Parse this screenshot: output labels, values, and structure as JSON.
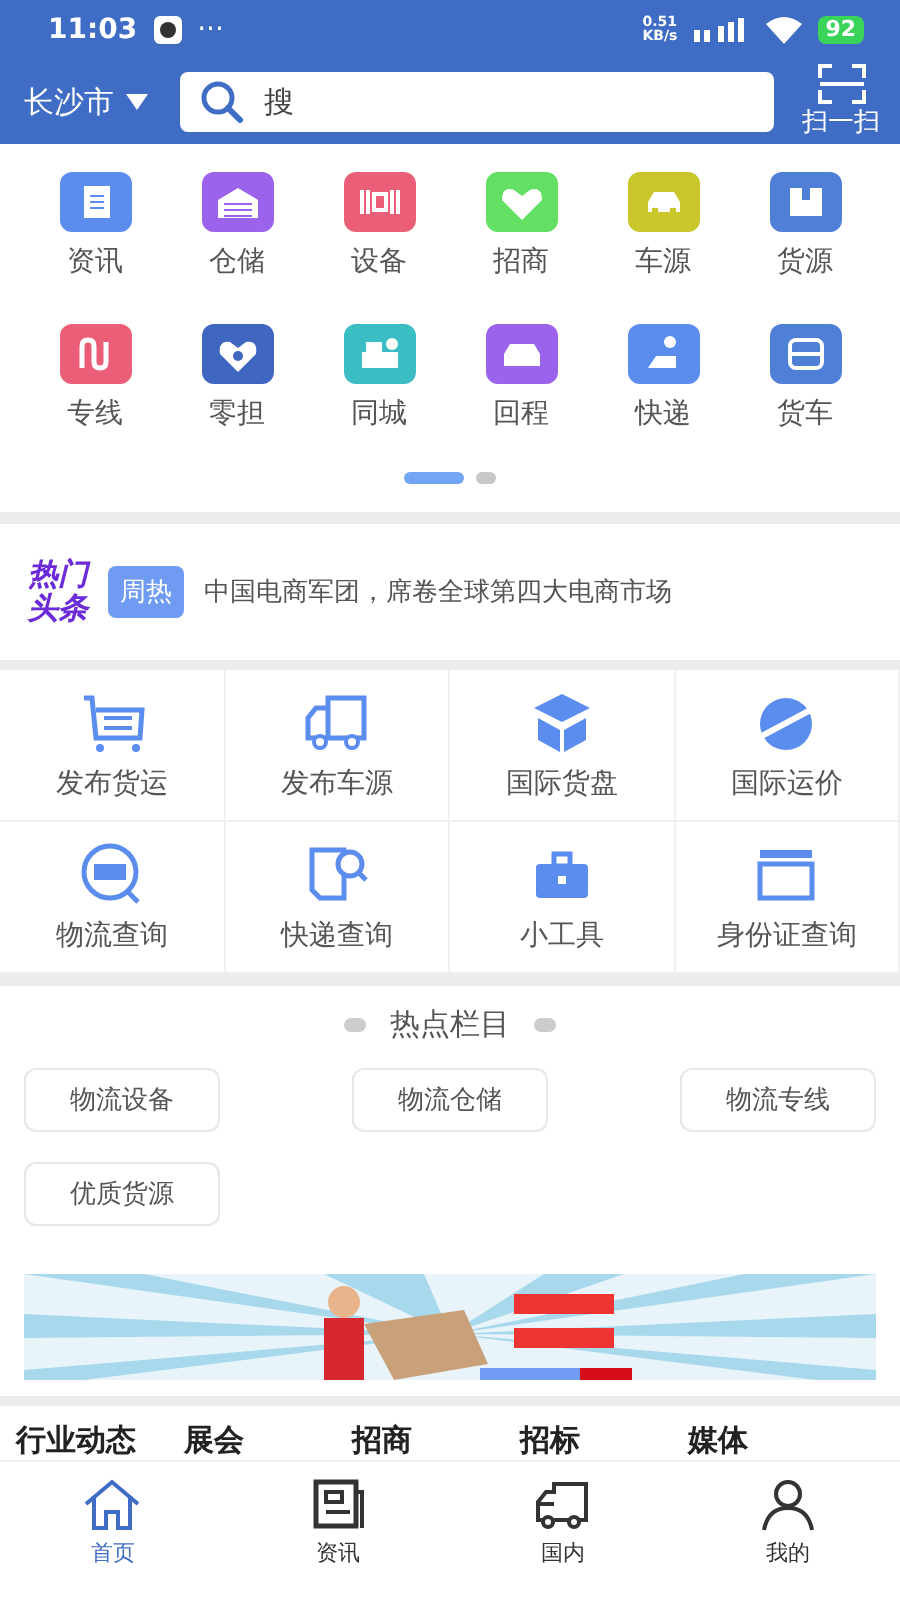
{
  "status_bar": {
    "time": "11:03",
    "more": "···",
    "speed": "0.51\nKB/s",
    "battery": "92"
  },
  "header": {
    "city": "长沙市",
    "search_placeholder": "搜",
    "scan_label": "扫一扫"
  },
  "categories": [
    {
      "label": "资讯",
      "color": "#5b8def"
    },
    {
      "label": "仓储",
      "color": "#9b63ec"
    },
    {
      "label": "设备",
      "color": "#eb5e78"
    },
    {
      "label": "招商",
      "color": "#63e063"
    },
    {
      "label": "车源",
      "color": "#c9c62c"
    },
    {
      "label": "货源",
      "color": "#4f7fd6"
    },
    {
      "label": "专线",
      "color": "#eb5e78"
    },
    {
      "label": "零担",
      "color": "#3f66c0"
    },
    {
      "label": "同城",
      "color": "#3bbdc4"
    },
    {
      "label": "回程",
      "color": "#9b63ec"
    },
    {
      "label": "快递",
      "color": "#5b8def"
    },
    {
      "label": "货车",
      "color": "#4f7fd6"
    }
  ],
  "pager": [
    {
      "selected": true
    },
    {
      "selected": false
    }
  ],
  "headline": {
    "logo": [
      "热门",
      "头条"
    ],
    "tag": "周热",
    "text": "中国电商军团，席卷全球第四大电商市场"
  },
  "services": [
    {
      "label": "发布货运"
    },
    {
      "label": "发布车源"
    },
    {
      "label": "国际货盘"
    },
    {
      "label": "国际运价"
    },
    {
      "label": "物流查询"
    },
    {
      "label": "快递查询"
    },
    {
      "label": "小工具"
    },
    {
      "label": "身份证查询"
    }
  ],
  "hot": {
    "title": "热点栏目",
    "chips": [
      "物流设备",
      "物流仓储",
      "物流专线",
      "优质货源"
    ]
  },
  "news_tabs": [
    "行业动态",
    "展会",
    "招商",
    "招标",
    "媒体"
  ],
  "nav": [
    {
      "label": "首页",
      "selected": true
    },
    {
      "label": "资讯",
      "selected": false
    },
    {
      "label": "国内",
      "selected": false
    },
    {
      "label": "我的",
      "selected": false
    }
  ]
}
